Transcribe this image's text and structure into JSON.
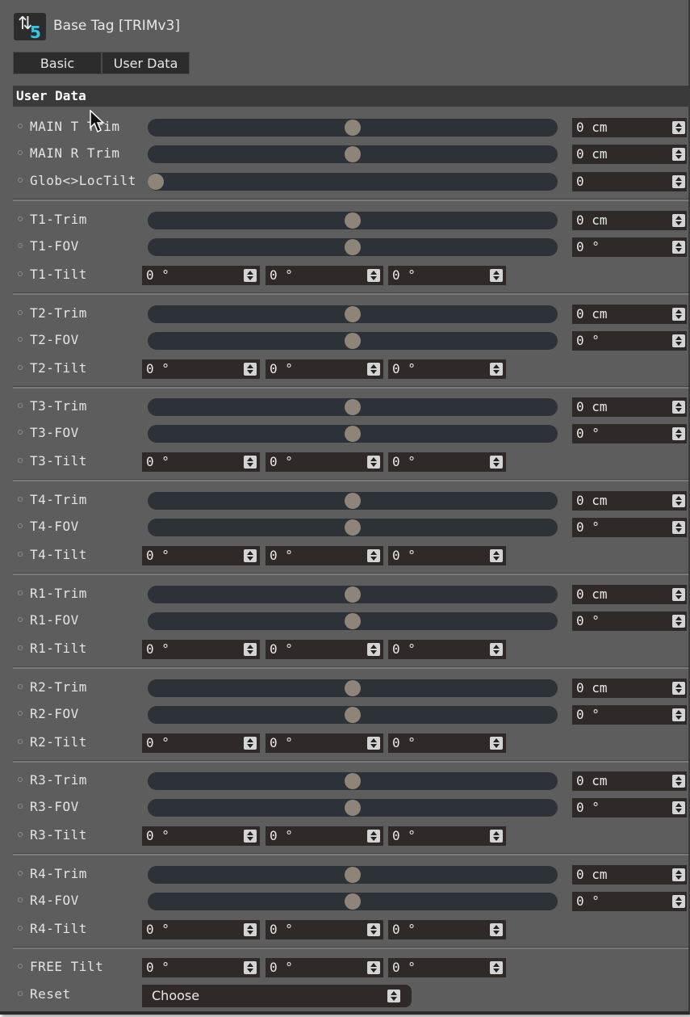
{
  "window": {
    "title": "Base Tag [TRIMv3]",
    "icon": "trim-plugin-icon"
  },
  "tabs": [
    {
      "label": "Basic"
    },
    {
      "label": "User Data"
    }
  ],
  "section": {
    "title": "User Data"
  },
  "main_rows": [
    {
      "label": "MAIN T Trim",
      "slider": 0.5,
      "value": "0 cm"
    },
    {
      "label": "MAIN R Trim",
      "slider": 0.5,
      "value": "0 cm"
    },
    {
      "label": "Glob<>LocTilt",
      "slider": 0.0,
      "value": "0"
    }
  ],
  "groups": [
    {
      "trim_label": "T1-Trim",
      "trim_value": "0 cm",
      "trim_slider": 0.5,
      "fov_label": "T1-FOV",
      "fov_value": "0 °",
      "fov_slider": 0.5,
      "tilt_label": "T1-Tilt",
      "tilt_values": [
        "0 °",
        "0 °",
        "0 °"
      ]
    },
    {
      "trim_label": "T2-Trim",
      "trim_value": "0 cm",
      "trim_slider": 0.5,
      "fov_label": "T2-FOV",
      "fov_value": "0 °",
      "fov_slider": 0.5,
      "tilt_label": "T2-Tilt",
      "tilt_values": [
        "0 °",
        "0 °",
        "0 °"
      ]
    },
    {
      "trim_label": "T3-Trim",
      "trim_value": "0 cm",
      "trim_slider": 0.5,
      "fov_label": "T3-FOV",
      "fov_value": "0 °",
      "fov_slider": 0.5,
      "tilt_label": "T3-Tilt",
      "tilt_values": [
        "0 °",
        "0 °",
        "0 °"
      ]
    },
    {
      "trim_label": "T4-Trim",
      "trim_value": "0 cm",
      "trim_slider": 0.5,
      "fov_label": "T4-FOV",
      "fov_value": "0 °",
      "fov_slider": 0.5,
      "tilt_label": "T4-Tilt",
      "tilt_values": [
        "0 °",
        "0 °",
        "0 °"
      ]
    },
    {
      "trim_label": "R1-Trim",
      "trim_value": "0 cm",
      "trim_slider": 0.5,
      "fov_label": "R1-FOV",
      "fov_value": "0 °",
      "fov_slider": 0.5,
      "tilt_label": "R1-Tilt",
      "tilt_values": [
        "0 °",
        "0 °",
        "0 °"
      ]
    },
    {
      "trim_label": "R2-Trim",
      "trim_value": "0 cm",
      "trim_slider": 0.5,
      "fov_label": "R2-FOV",
      "fov_value": "0 °",
      "fov_slider": 0.5,
      "tilt_label": "R2-Tilt",
      "tilt_values": [
        "0 °",
        "0 °",
        "0 °"
      ]
    },
    {
      "trim_label": "R3-Trim",
      "trim_value": "0 cm",
      "trim_slider": 0.5,
      "fov_label": "R3-FOV",
      "fov_value": "0 °",
      "fov_slider": 0.5,
      "tilt_label": "R3-Tilt",
      "tilt_values": [
        "0 °",
        "0 °",
        "0 °"
      ]
    },
    {
      "trim_label": "R4-Trim",
      "trim_value": "0 cm",
      "trim_slider": 0.5,
      "fov_label": "R4-FOV",
      "fov_value": "0 °",
      "fov_slider": 0.5,
      "tilt_label": "R4-Tilt",
      "tilt_values": [
        "0 °",
        "0 °",
        "0 °"
      ]
    }
  ],
  "free_tilt": {
    "label": "FREE Tilt",
    "values": [
      "0 °",
      "0 °",
      "0 °"
    ]
  },
  "reset": {
    "label": "Reset",
    "selected": "Choose"
  },
  "colors": {
    "panel_bg": "#5d5d5d",
    "field_bg": "#2f2a28",
    "slider_track": "#2d3238",
    "slider_thumb": "#8f8478",
    "header_bg": "#3a3a3a",
    "accent_icon": "#31c8e8"
  }
}
